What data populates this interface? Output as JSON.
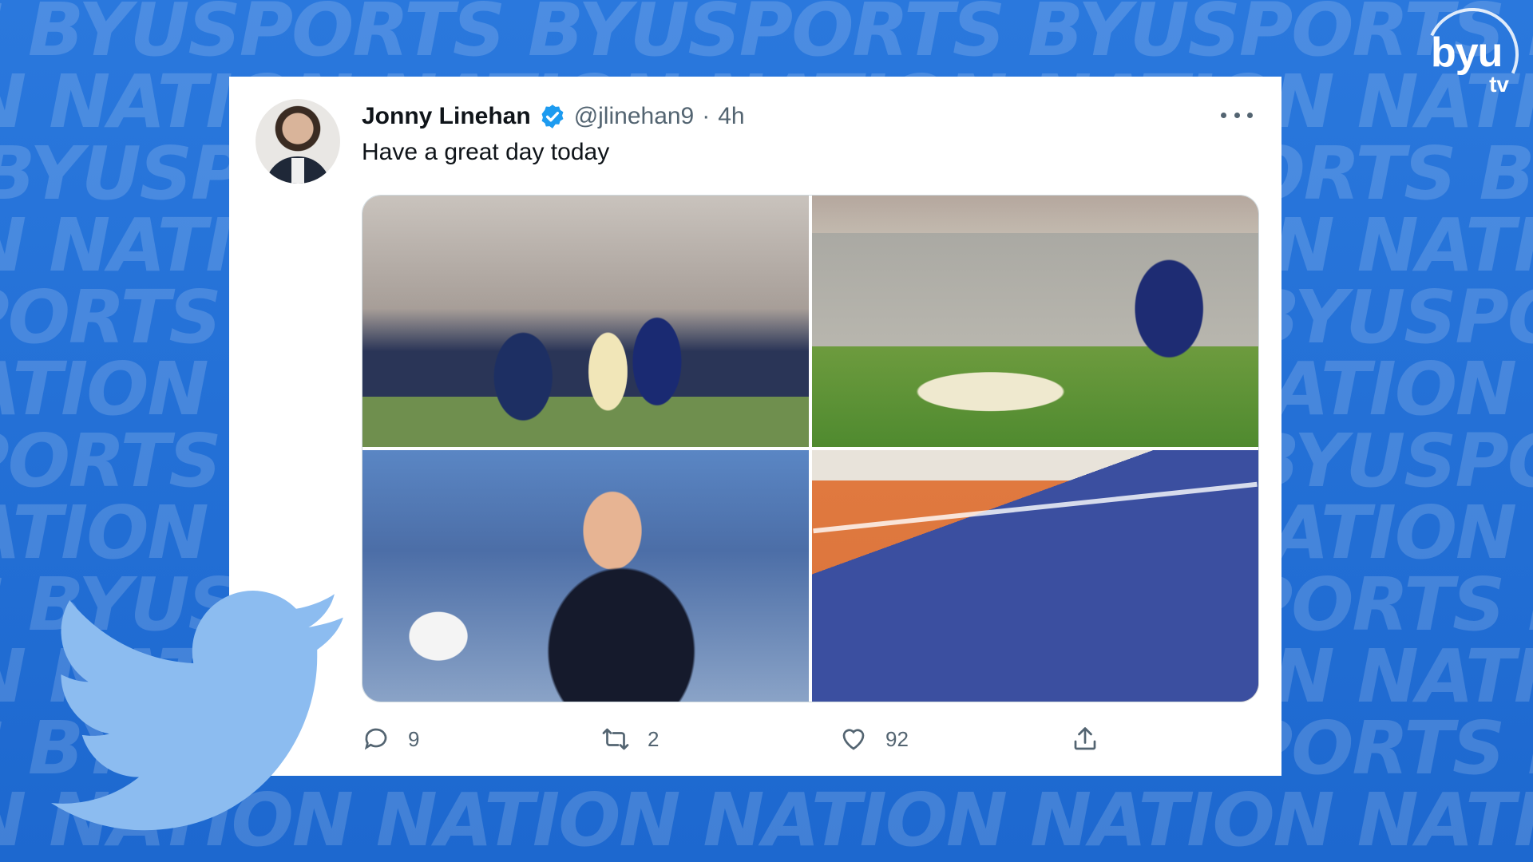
{
  "background": {
    "rows": [
      "TS BYUSPORTS BYUSPORTS BYUSPORTS BYUSPORTS BYUSPORTS",
      "ON NATION NATION NATION NATION NATION NATION NATION",
      "S BYUSPORTS BYUSPORTS BYUSPORTS BYUSPORTS BYUSPORTS",
      "ON NATION NATION NATION NATION NATION NATION NATION",
      "SPORTS BYUSPORTS BYUSPORTS BYUSPORTS BYUSPORTS BYU",
      "NATION NATION NATION NATION NATION NATION NATION",
      "SPORTS BYUSPORTS BYUSPORTS BYUSPORTS BYUSPORTS BYU",
      "NATION NATION NATION NATION NATION NATION NATION",
      "TS BYUSPORTS BYUSPORTS BYUSPORTS BYUSPORTS BYUSPORTS",
      "ON NATION NATION NATION NATION NATION NATION NATION",
      "TS BYUSPORTS BYUSPORTS BYUSPORTS BYUSPORTS BYUSPORTS",
      "ON NATION NATION NATION NATION NATION NATION NATION"
    ],
    "color": "#1f6fd6"
  },
  "logo": {
    "line1": "byu",
    "line2": "tv"
  },
  "tweet": {
    "author_name": "Jonny Linehan",
    "handle": "@jlinehan9",
    "separator": "·",
    "time": "4h",
    "text": "Have a great day today",
    "verified_icon": "verified-badge-icon",
    "media_count": 4,
    "replies": "9",
    "retweets": "2",
    "likes": "92"
  },
  "colors": {
    "twitter_blue": "#1d9bf0",
    "bird_light_blue": "#8cbcf0",
    "text_primary": "#0f1419",
    "text_secondary": "#536471"
  }
}
